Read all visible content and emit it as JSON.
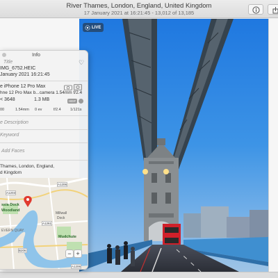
{
  "window": {
    "title": "River Thames, London, England, United Kingdom",
    "subtitle": "17 January 2021 at 16:21:45  -  13,012 of 13,185"
  },
  "toolbar": {
    "info_icon": "info-icon",
    "share_icon": "share-icon"
  },
  "photo": {
    "live_label": "LIVE",
    "colors": {
      "sky": "#2f8ee8",
      "bridge": "#3b4954"
    }
  },
  "info_panel": {
    "header": "Info",
    "title_placeholder": "Title",
    "filename": "IMG_6752.HEIC",
    "date": "January 2021   16:21:45",
    "camera": "e iPhone 12 Pro Max",
    "lens": "hne 12 Pro Max b...camera 1.54mm f/2.4",
    "dimensions": "< 3648",
    "filesize": "1.3 MB",
    "format_badge": "HEIF",
    "stats": [
      "00",
      "1.54mm",
      "0 ev",
      "f/2.4",
      "1/121s"
    ],
    "description_placeholder": "e Description",
    "keyword_placeholder": "Keyword",
    "faces_placeholder": "Add Faces",
    "location_line1": "Thames, London, England,",
    "location_line2": "d Kingdom"
  },
  "map": {
    "labels": [
      "ssia Dock",
      "Woodland",
      "Millwall",
      "Dock",
      "Mudchute",
      "EVERN QUAY",
      "A1206",
      "A1203",
      "A1261",
      "B206",
      "A1206"
    ],
    "zoom_out": "−",
    "zoom_in": "+"
  }
}
